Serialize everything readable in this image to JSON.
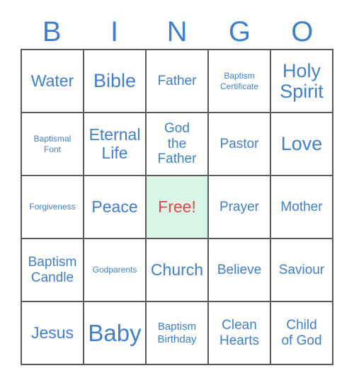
{
  "header": {
    "letters": [
      "B",
      "I",
      "N",
      "G",
      "O"
    ],
    "color": "#3f7fcc"
  },
  "colors": {
    "text": "#3f7fcc",
    "free_text": "#e04747",
    "free_background": "#d9f5e7",
    "grid_border": "#5a5a5a",
    "page_background": "#ffffff"
  },
  "grid": {
    "rows": 5,
    "columns": 5,
    "cells": [
      {
        "label": "Water",
        "size": "lg",
        "free": false
      },
      {
        "label": "Bible",
        "size": "xl",
        "free": false
      },
      {
        "label": "Father",
        "size": "md",
        "free": false
      },
      {
        "label": "Baptism\nCertificate",
        "size": "xs",
        "free": false
      },
      {
        "label": "Holy\nSpirit",
        "size": "xl",
        "free": false
      },
      {
        "label": "Baptismal\nFont",
        "size": "xs",
        "free": false
      },
      {
        "label": "Eternal\nLife",
        "size": "lg",
        "free": false
      },
      {
        "label": "God\nthe\nFather",
        "size": "md",
        "free": false
      },
      {
        "label": "Pastor",
        "size": "md",
        "free": false
      },
      {
        "label": "Love",
        "size": "xl",
        "free": false
      },
      {
        "label": "Forgiveness",
        "size": "xs",
        "free": false
      },
      {
        "label": "Peace",
        "size": "lg",
        "free": false
      },
      {
        "label": "Free!",
        "size": "lg",
        "free": true
      },
      {
        "label": "Prayer",
        "size": "md",
        "free": false
      },
      {
        "label": "Mother",
        "size": "md",
        "free": false
      },
      {
        "label": "Baptism\nCandle",
        "size": "md",
        "free": false
      },
      {
        "label": "Godparents",
        "size": "xs",
        "free": false
      },
      {
        "label": "Church",
        "size": "lg",
        "free": false
      },
      {
        "label": "Believe",
        "size": "md",
        "free": false
      },
      {
        "label": "Saviour",
        "size": "md",
        "free": false
      },
      {
        "label": "Jesus",
        "size": "lg",
        "free": false
      },
      {
        "label": "Baby",
        "size": "xxl",
        "free": false
      },
      {
        "label": "Baptism\nBirthday",
        "size": "sm",
        "free": false
      },
      {
        "label": "Clean\nHearts",
        "size": "md",
        "free": false
      },
      {
        "label": "Child\nof God",
        "size": "md",
        "free": false
      }
    ]
  }
}
